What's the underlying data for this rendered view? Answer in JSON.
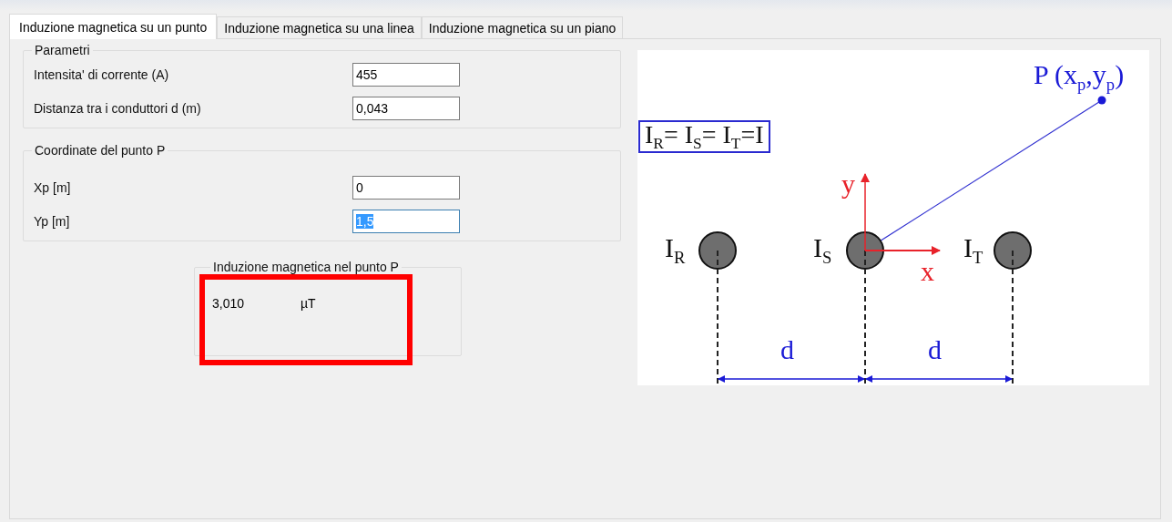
{
  "tabs": [
    {
      "label": "Induzione magnetica su un punto",
      "selected": true
    },
    {
      "label": "Induzione magnetica su una linea",
      "selected": false
    },
    {
      "label": "Induzione magnetica su un piano",
      "selected": false
    }
  ],
  "parameters": {
    "title": "Parametri",
    "fields": [
      {
        "label": "Intensita' di corrente (A)",
        "value": "455",
        "focused": false
      },
      {
        "label": "Distanza tra i conduttori d (m)",
        "value": "0,043",
        "focused": false
      }
    ]
  },
  "point": {
    "title": "Coordinate del punto P",
    "fields": [
      {
        "label": "Xp [m]",
        "value": "0",
        "focused": false
      },
      {
        "label": "Yp [m]",
        "value": "1,5",
        "focused": true
      }
    ]
  },
  "result": {
    "title": "Induzione magnetica nel punto P",
    "value": "3,010",
    "unit": "µT",
    "highlighted": true
  },
  "diagram": {
    "formula": "I$_{R}$= I$_{S}$= I$_{T}$=I",
    "point_label": "P (x$_{p}$,y$_{p}$)",
    "conductors": [
      {
        "label": "I$_{R}$"
      },
      {
        "label": "I$_{S}$"
      },
      {
        "label": "I$_{T}$"
      }
    ],
    "axis_x": "x",
    "axis_y": "y",
    "spacings": [
      "d",
      "d"
    ]
  }
}
